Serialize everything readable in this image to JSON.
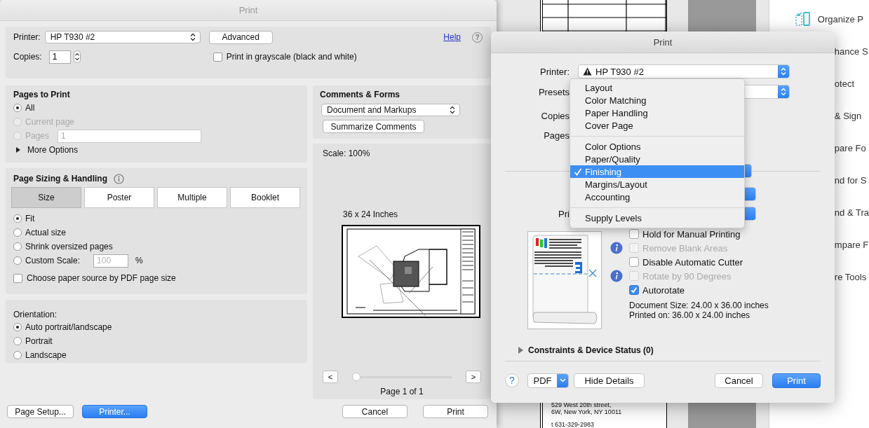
{
  "background_document": {
    "address_lines": [
      "529 West 20th street,",
      "6W, New York, NY 10011",
      "t 631-329-2983"
    ]
  },
  "tools_panel": {
    "items": [
      {
        "label": "Organize P",
        "kind": "icon"
      },
      {
        "label": "hance S",
        "kind": "clipped"
      },
      {
        "label": "otect",
        "kind": "clipped"
      },
      {
        "label": "& Sign",
        "kind": "clipped"
      },
      {
        "label": "pare Fo",
        "kind": "clipped"
      },
      {
        "label": "nd for S",
        "kind": "clipped"
      },
      {
        "label": "nd & Tra",
        "kind": "clipped"
      },
      {
        "label": "mpare F",
        "kind": "clipped"
      },
      {
        "label": "re Tools",
        "kind": "clipped"
      }
    ]
  },
  "acrobat_print": {
    "title": "Print",
    "printer": {
      "label": "Printer:",
      "value": "HP T930 #2"
    },
    "advanced_button": "Advanced",
    "help_link": "Help",
    "help_button": "?",
    "copies": {
      "label": "Copies:",
      "value": "1"
    },
    "grayscale": {
      "label": "Print in grayscale (black and white)",
      "checked": false
    },
    "pages_to_print": {
      "title": "Pages to Print",
      "options": [
        {
          "label": "All",
          "selected": true,
          "disabled": false
        },
        {
          "label": "Current page",
          "selected": false,
          "disabled": true
        },
        {
          "label": "Pages",
          "selected": false,
          "disabled": true
        }
      ],
      "pages_value": "1",
      "more_options": {
        "label": "More Options",
        "expanded": false
      }
    },
    "page_sizing": {
      "title": "Page Sizing & Handling",
      "tabs": [
        {
          "label": "Size",
          "selected": true
        },
        {
          "label": "Poster",
          "selected": false
        },
        {
          "label": "Multiple",
          "selected": false
        },
        {
          "label": "Booklet",
          "selected": false
        }
      ],
      "options": [
        {
          "label": "Fit",
          "selected": true
        },
        {
          "label": "Actual size",
          "selected": false
        },
        {
          "label": "Shrink oversized pages",
          "selected": false
        },
        {
          "label": "Custom Scale:",
          "selected": false
        }
      ],
      "custom_scale": {
        "placeholder": "100",
        "unit": "%"
      },
      "paper_source": {
        "label": "Choose paper source by PDF page size",
        "checked": false
      }
    },
    "orientation": {
      "title": "Orientation:",
      "options": [
        {
          "label": "Auto portrait/landscape",
          "selected": true
        },
        {
          "label": "Portrait",
          "selected": false
        },
        {
          "label": "Landscape",
          "selected": false
        }
      ]
    },
    "comments_forms": {
      "title": "Comments & Forms",
      "value": "Document and Markups",
      "summarize_button": "Summarize Comments"
    },
    "preview": {
      "scale": "Scale: 100%",
      "page_size": "36 x 24 Inches",
      "prev": "<",
      "next": ">",
      "slider": {
        "level": 0
      },
      "page_label": "Page 1 of 1"
    },
    "left_buttons": [
      {
        "label": "Page Setup...",
        "kind": "default"
      },
      {
        "label": "Printer...",
        "kind": "primary"
      }
    ],
    "right_buttons": [
      {
        "label": "Cancel"
      },
      {
        "label": "Print"
      }
    ]
  },
  "mac_print": {
    "title": "Print",
    "printer": {
      "label": "Printer:",
      "value": "HP T930 #2",
      "warning": true
    },
    "rows": [
      {
        "label": "Presets"
      },
      {
        "label": "Copies"
      },
      {
        "label": "Pages"
      }
    ],
    "menu": {
      "groups": [
        [
          {
            "label": "Layout",
            "selected": false
          },
          {
            "label": "Color Matching",
            "selected": false
          },
          {
            "label": "Paper Handling",
            "selected": false
          },
          {
            "label": "Cover Page",
            "selected": false
          }
        ],
        [
          {
            "label": "Color Options",
            "selected": false
          },
          {
            "label": "Paper/Quality",
            "selected": false
          },
          {
            "label": "Finishing",
            "selected": true
          },
          {
            "label": "Margins/Layout",
            "selected": false
          },
          {
            "label": "Accounting",
            "selected": false
          }
        ],
        [
          {
            "label": "Supply Levels",
            "selected": false
          }
        ]
      ]
    },
    "partial_label": "Pri",
    "options": [
      {
        "label": "Hold for Manual Printing",
        "checked": false,
        "disabled": false,
        "info": false
      },
      {
        "label": "Remove Blank Areas",
        "checked": false,
        "disabled": true,
        "info": true
      },
      {
        "label": "Disable Automatic Cutter",
        "checked": false,
        "disabled": false,
        "info": false
      },
      {
        "label": "Rotate by 90 Degrees",
        "checked": false,
        "disabled": true,
        "info": true
      },
      {
        "label": "Autorotate",
        "checked": true,
        "disabled": false,
        "info": false
      }
    ],
    "document_size": "Document Size: 24.00 x 36.00 inches",
    "printed_on": "Printed on: 36.00 x 24.00 inches",
    "constraints": {
      "label": "Constraints & Device Status (0)",
      "expanded": false
    },
    "help_button": "?",
    "pdf_button": "PDF",
    "hide_details_button": "Hide Details",
    "cancel_button": "Cancel",
    "print_button": "Print"
  }
}
